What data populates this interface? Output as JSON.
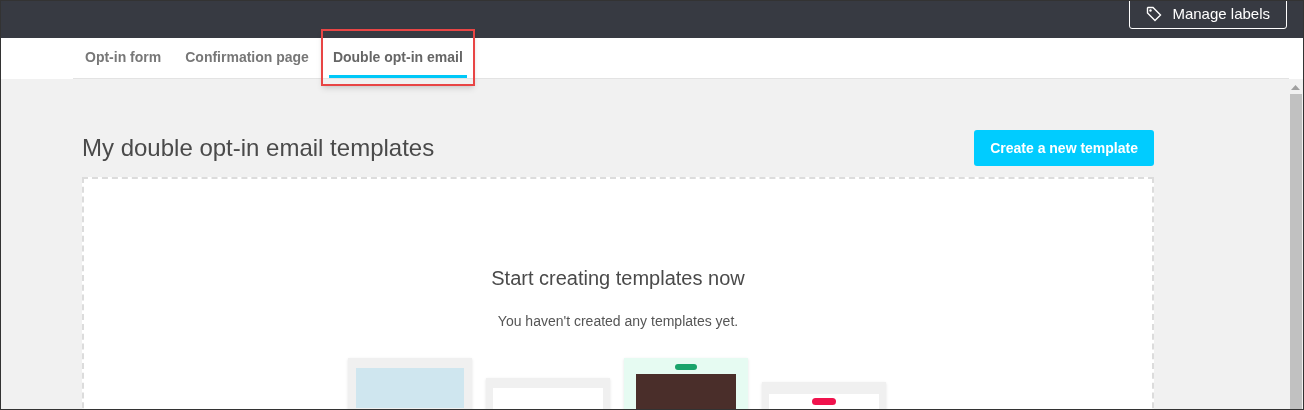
{
  "header": {
    "manage_labels_button": "Manage labels"
  },
  "tabs": [
    {
      "label": "Opt-in form",
      "selected": false,
      "highlighted": false
    },
    {
      "label": "Confirmation page",
      "selected": false,
      "highlighted": false
    },
    {
      "label": "Double opt-in email",
      "selected": true,
      "highlighted": true
    }
  ],
  "page": {
    "title": "My double opt-in email templates",
    "create_button": "Create a new template"
  },
  "empty_state": {
    "heading": "Start creating templates now",
    "message": "You haven't created any templates yet."
  }
}
